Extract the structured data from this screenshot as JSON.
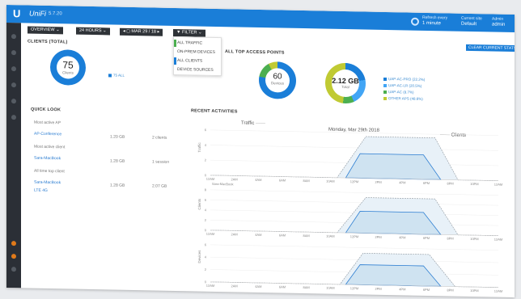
{
  "app": {
    "logo": "U",
    "brand": "UniFi",
    "subbrand": "5.7.20"
  },
  "topbar": {
    "refresh_label": "Refresh every",
    "refresh_value": "1 minute",
    "site_label": "Current site",
    "site_value": "Default",
    "user_label": "Admin",
    "user_value": "admin"
  },
  "toolbar": {
    "overview": "OVERVIEW ⌄",
    "hours": "24 HOURS ⌄",
    "range": "◂ ◻ MAR 29 / 18 ▸",
    "filter": "▼ FILTER ⌄",
    "clear": "CLEAR CURRENT STATS"
  },
  "filter_menu": {
    "items": [
      {
        "label": "ALL TRAFFIC",
        "color": "#4caf50"
      },
      {
        "label": "ON-PREM DEVICES",
        "color": "#ffffff"
      },
      {
        "label": "ALL CLIENTS",
        "color": "#1a7ed8"
      },
      {
        "label": "DEVICE SOURCES",
        "color": "#ffffff"
      }
    ]
  },
  "clients": {
    "title": "CLIENTS (TOTAL)",
    "value": "75",
    "unit": "Clients",
    "legend": "75 ALL"
  },
  "aps": {
    "title": "ALL TOP ACCESS POINTS",
    "count_value": "60",
    "count_unit": "Devices",
    "traffic_value": "2.12 GB",
    "traffic_unit": "Total",
    "legend": [
      {
        "label": "UAP-AC-PRO (22.2%)",
        "color": "#1a7ed8"
      },
      {
        "label": "UAP-AC-LR (20.5%)",
        "color": "#42a5f5"
      },
      {
        "label": "UAP-AC (8.7%)",
        "color": "#4caf50"
      },
      {
        "label": "OTHER APS (48.6%)",
        "color": "#c0ca33"
      }
    ]
  },
  "quick_look": {
    "title": "QUICK LOOK",
    "rows": [
      {
        "label": "Most active AP",
        "v1": "",
        "v2": "",
        "type": "grey"
      },
      {
        "label": "AP-Conference",
        "v1": "1.20 GB",
        "v2": "2 clients",
        "type": "link"
      },
      {
        "label": "Most active client",
        "v1": "",
        "v2": "",
        "type": "grey"
      },
      {
        "label": "Sara-MacBook",
        "v1": "1.28 GB",
        "v2": "1 session",
        "type": "link"
      },
      {
        "label": "All time top client",
        "v1": "",
        "v2": "",
        "type": "grey"
      },
      {
        "label": "Sara-MacBook",
        "v1": "1.28 GB",
        "v2": "2.07 GB",
        "type": "link"
      },
      {
        "label": "LTE 4G",
        "v1": "",
        "v2": "",
        "type": "grey"
      }
    ]
  },
  "recent_activity": {
    "title": "RECENT ACTIVITIES",
    "legend_left": "Traffic",
    "date": "Monday, Mar 29th 2018",
    "legend_right": "Clients"
  },
  "charts": [
    {
      "ylabel": "Traffic",
      "yticks": [
        "6",
        "4",
        "2",
        "0"
      ],
      "legend": "Sara-MacBook"
    },
    {
      "ylabel": "Clients",
      "yticks": [
        "8",
        "6",
        "4",
        "2",
        "0"
      ],
      "legend": ""
    },
    {
      "ylabel": "Devices",
      "yticks": [
        "6",
        "4",
        "2",
        "0"
      ],
      "legend": ""
    }
  ],
  "time_ticks": [
    "12AM",
    "2AM",
    "4AM",
    "6AM",
    "8AM",
    "10AM",
    "12PM",
    "2PM",
    "4PM",
    "6PM",
    "8PM",
    "10PM",
    "12AM"
  ],
  "colors": {
    "accent": "#1a7ed8",
    "green": "#4caf50",
    "lime": "#c0ca33",
    "sidebar": "#2b2f36"
  }
}
